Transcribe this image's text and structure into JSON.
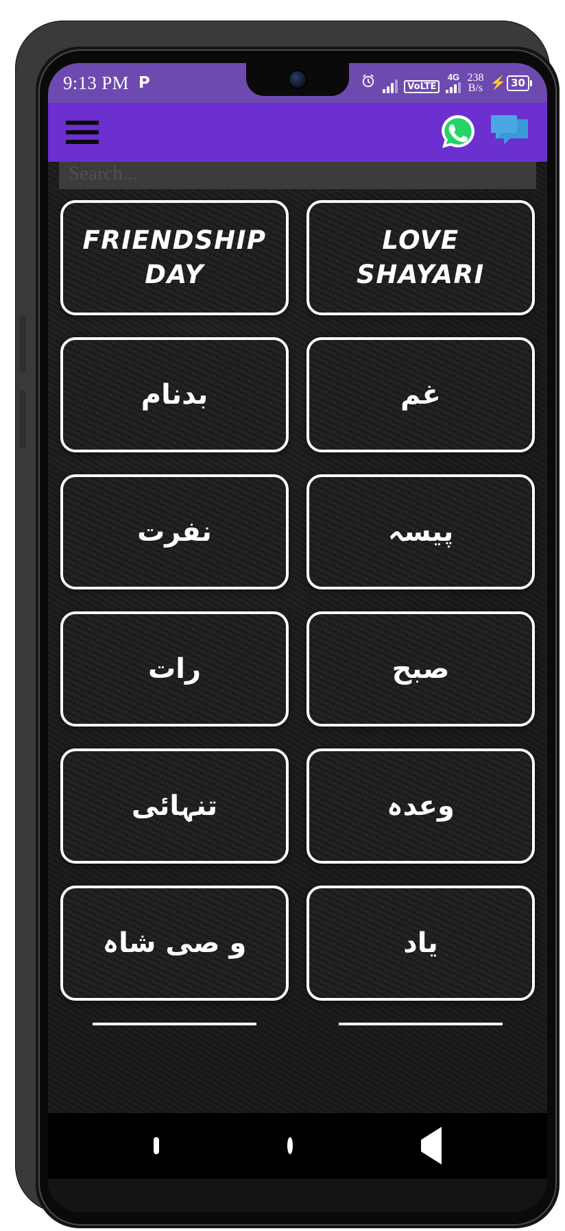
{
  "statusbar": {
    "time": "9:13 PM",
    "pinterest_icon": "P",
    "alarm_icon": "alarm-clock",
    "volte_label": "VoLTE",
    "network_gen": "4G",
    "net_speed_value": "238",
    "net_speed_unit": "B/s",
    "charging_bolt": "⚡",
    "battery_level": "30",
    "accent_color": "#6d4ab0"
  },
  "appbar": {
    "menu_icon": "hamburger-menu",
    "whatsapp_icon": "whatsapp",
    "chat_icon": "chat-bubble",
    "background_color": "#6c2fd0",
    "whatsapp_color": "#25d366",
    "chat_color": "#3a9ad9"
  },
  "search": {
    "placeholder": "Search...",
    "value": ""
  },
  "grid": {
    "tiles": [
      {
        "label": "FRIENDSHIP DAY",
        "script": "latin"
      },
      {
        "label": "LOVE SHAYARI",
        "script": "latin"
      },
      {
        "label": "بدنام",
        "script": "urdu"
      },
      {
        "label": "غم",
        "script": "urdu"
      },
      {
        "label": "نفرت",
        "script": "urdu"
      },
      {
        "label": "پیسہ",
        "script": "urdu"
      },
      {
        "label": "رات",
        "script": "urdu"
      },
      {
        "label": "صبح",
        "script": "urdu"
      },
      {
        "label": "تنہائی",
        "script": "urdu"
      },
      {
        "label": "وعدہ",
        "script": "urdu"
      },
      {
        "label": "و صی شاہ",
        "script": "urdu"
      },
      {
        "label": "یاد",
        "script": "urdu"
      }
    ]
  },
  "navbar": {
    "recents_icon": "square-recents",
    "home_icon": "circle-home",
    "back_icon": "triangle-back"
  }
}
